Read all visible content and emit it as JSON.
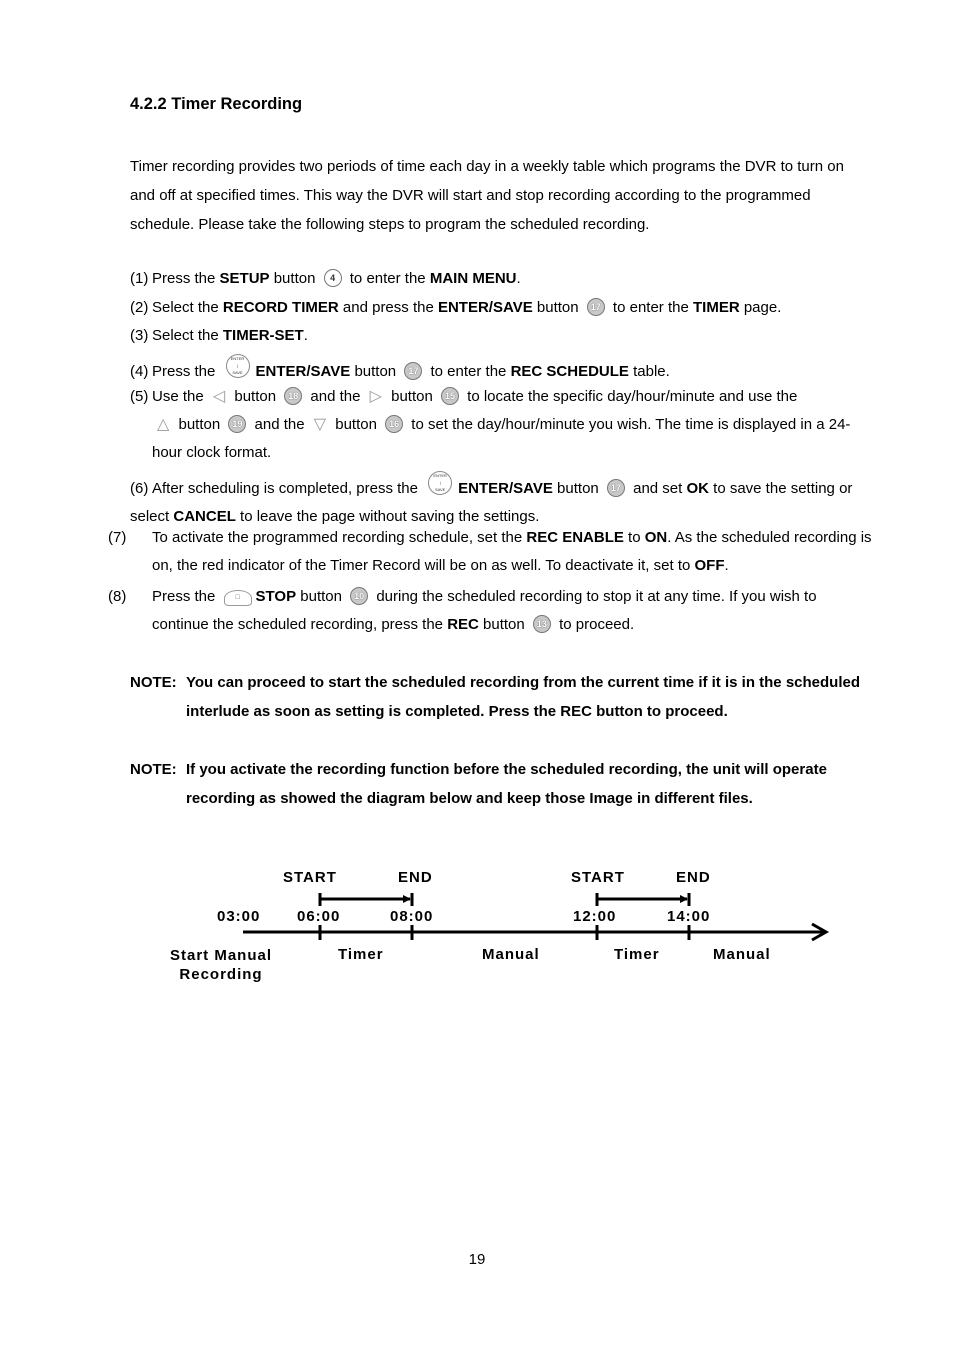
{
  "heading": "4.2.2 Timer Recording",
  "intro": "Timer recording provides two periods of time each day in a weekly table which programs the DVR to turn on and off at specified times. This way the DVR will start and stop recording according to the programmed schedule. Please take the following steps to program the scheduled recording.",
  "steps": {
    "s1": {
      "num": "(1)",
      "a": "Press the ",
      "b1": "SETUP",
      "c": " button ",
      "icon": "4",
      "d": " to enter the ",
      "b2": "MAIN MENU",
      "e": "."
    },
    "s2": {
      "num": "(2)",
      "a": "Select the ",
      "b1": "RECORD TIMER",
      "c": " and press the ",
      "b2": "ENTER/SAVE",
      "d": " button ",
      "icon": "17",
      "e": " to enter the ",
      "b3": "TIMER",
      "f": " page."
    },
    "s3": {
      "num": "(3)",
      "a": "Select the ",
      "b1": "TIMER-SET",
      "e": "."
    },
    "s4": {
      "num": "(4)",
      "a": "Press the ",
      "b1": "ENTER/SAVE",
      "c": " button ",
      "icon": "17",
      "d": " to enter the ",
      "b2": "REC SCHEDULE",
      "e": " table."
    },
    "s5": {
      "num": "(5)",
      "a": "Use the ",
      "b": " button ",
      "i1": "18",
      "c": " and the ",
      "d": " button ",
      "i2": "15",
      "e": " to locate the specific day/hour/minute and use the",
      "f": " button ",
      "i3": "19",
      "g": " and the ",
      "h": " button ",
      "i4": "16",
      "i": " to set the day/hour/minute you wish. The time is displayed in a 24-hour clock format."
    },
    "s6": {
      "num": "(6)",
      "a": "After scheduling is completed, press the ",
      "b1": "ENTER/SAVE",
      "c": " button ",
      "icon": "17",
      "d": " and set ",
      "b2": "OK",
      "e": " to save the setting or select ",
      "b3": "CANCEL",
      "f": " to leave the page without saving the settings."
    },
    "s7": {
      "num": "(7)",
      "a": "To activate the programmed recording schedule, set the ",
      "b1": "REC ENABLE",
      "c": " to ",
      "b2": "ON",
      "d": ". As the scheduled recording is on, the red indicator of the Timer Record will be on as well. To deactivate it, set to ",
      "b3": "OFF",
      "e": "."
    },
    "s8": {
      "num": "(8)",
      "a": "Press the ",
      "b1": "STOP",
      "c": " button ",
      "i1": "10",
      "d": " during the scheduled recording to stop it at any time. If you wish to continue the scheduled recording, press the ",
      "b2": "REC",
      "e": " button ",
      "i2": "13",
      "f": " to proceed."
    }
  },
  "enter_icon": {
    "top": "ENTER",
    "bottom": "SAVE"
  },
  "arrows": {
    "left": "◁",
    "right": "▷",
    "up": "△",
    "down": "▽"
  },
  "notes": [
    {
      "label": "NOTE:",
      "text": "You can proceed to start the scheduled recording from the current time if it is in the scheduled interlude as soon as setting is completed. Press the REC button to proceed."
    },
    {
      "label": "NOTE:",
      "text": "If you activate the recording function before the scheduled recording, the unit will operate recording as showed the diagram below and keep those Image in different files."
    }
  ],
  "diagram": {
    "times": [
      "03:00",
      "06:00",
      "08:00",
      "12:00",
      "14:00"
    ],
    "markers": [
      "START",
      "END",
      "START",
      "END"
    ],
    "segments": [
      "Start Manual Recording",
      "Timer",
      "Manual",
      "Timer",
      "Manual"
    ]
  },
  "page_number": "19"
}
